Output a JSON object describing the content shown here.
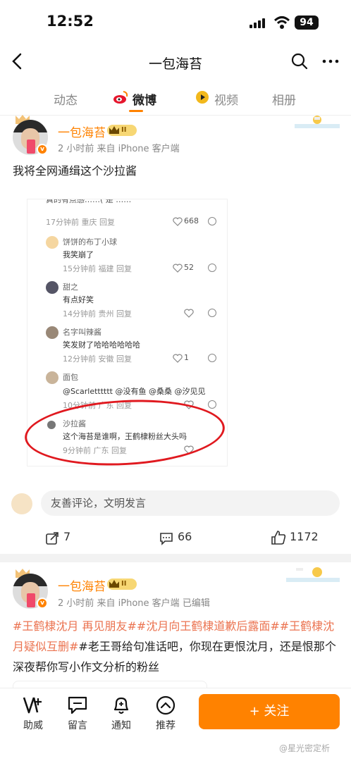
{
  "status": {
    "time": "12:52",
    "battery": "94"
  },
  "nav": {
    "title": "一包海苔"
  },
  "tabs": [
    {
      "label": "动态"
    },
    {
      "label": "微博"
    },
    {
      "label": "视频"
    },
    {
      "label": "相册"
    }
  ],
  "post1": {
    "username": "一包海苔",
    "level": "II",
    "meta": "2 小时前   来自 iPhone 客户端",
    "text": "我将全网通缉这个沙拉酱",
    "screenshot": {
      "top_cut": "真的有点感……( 是 ……",
      "comments": [
        {
          "name": "",
          "text": "",
          "meta": "17分钟前  重庆   回复",
          "likes": "668"
        },
        {
          "name": "饼饼的布丁小球",
          "text": "我笑崩了",
          "meta": "15分钟前  福建   回复",
          "likes": "52"
        },
        {
          "name": "甜之",
          "text": "有点好笑",
          "meta": "14分钟前  贵州   回复",
          "likes": ""
        },
        {
          "name": "名字叫辣酱",
          "text": "笑发财了哈哈哈哈哈哈",
          "meta": "12分钟前  安徽   回复",
          "likes": "1"
        },
        {
          "name": "面包",
          "text": "@Scarletttttt  @没有鱼  @桑桑  @汐见见",
          "meta": "10分钟前  广东   回复",
          "likes": ""
        },
        {
          "name": "沙拉酱",
          "text": "这个海苔是谁啊，王鹤棣粉丝大头吗",
          "meta": "9分钟前  广东   回复",
          "likes": ""
        }
      ]
    },
    "comment_placeholder": "友善评论，文明发言",
    "reposts": "7",
    "comments_count": "66",
    "likes": "1172"
  },
  "post2": {
    "username": "一包海苔",
    "level": "II",
    "meta": "2 小时前   来自 iPhone 客户端   已编辑",
    "text_parts": {
      "t1": "#王鹤棣沈月 再见朋友#",
      "t2": "#沈月向王鹤棣道歉后露面#",
      "t3": "#王鹤棣沈月疑似互删#",
      "t4": "#老王哥给句准话吧",
      "t5": "，你现在更恨沈月，还是恨那个深夜帮你写小作文分析的粉丝"
    }
  },
  "toolbar": {
    "help": "助威",
    "msg": "留言",
    "notify": "通知",
    "recommend": "推荐",
    "follow": "+ 关注"
  },
  "watermark": "@星光密定析",
  "colors": {
    "accent": "#ff8200",
    "topic": "#eb7350",
    "circle": "#e0191f"
  }
}
